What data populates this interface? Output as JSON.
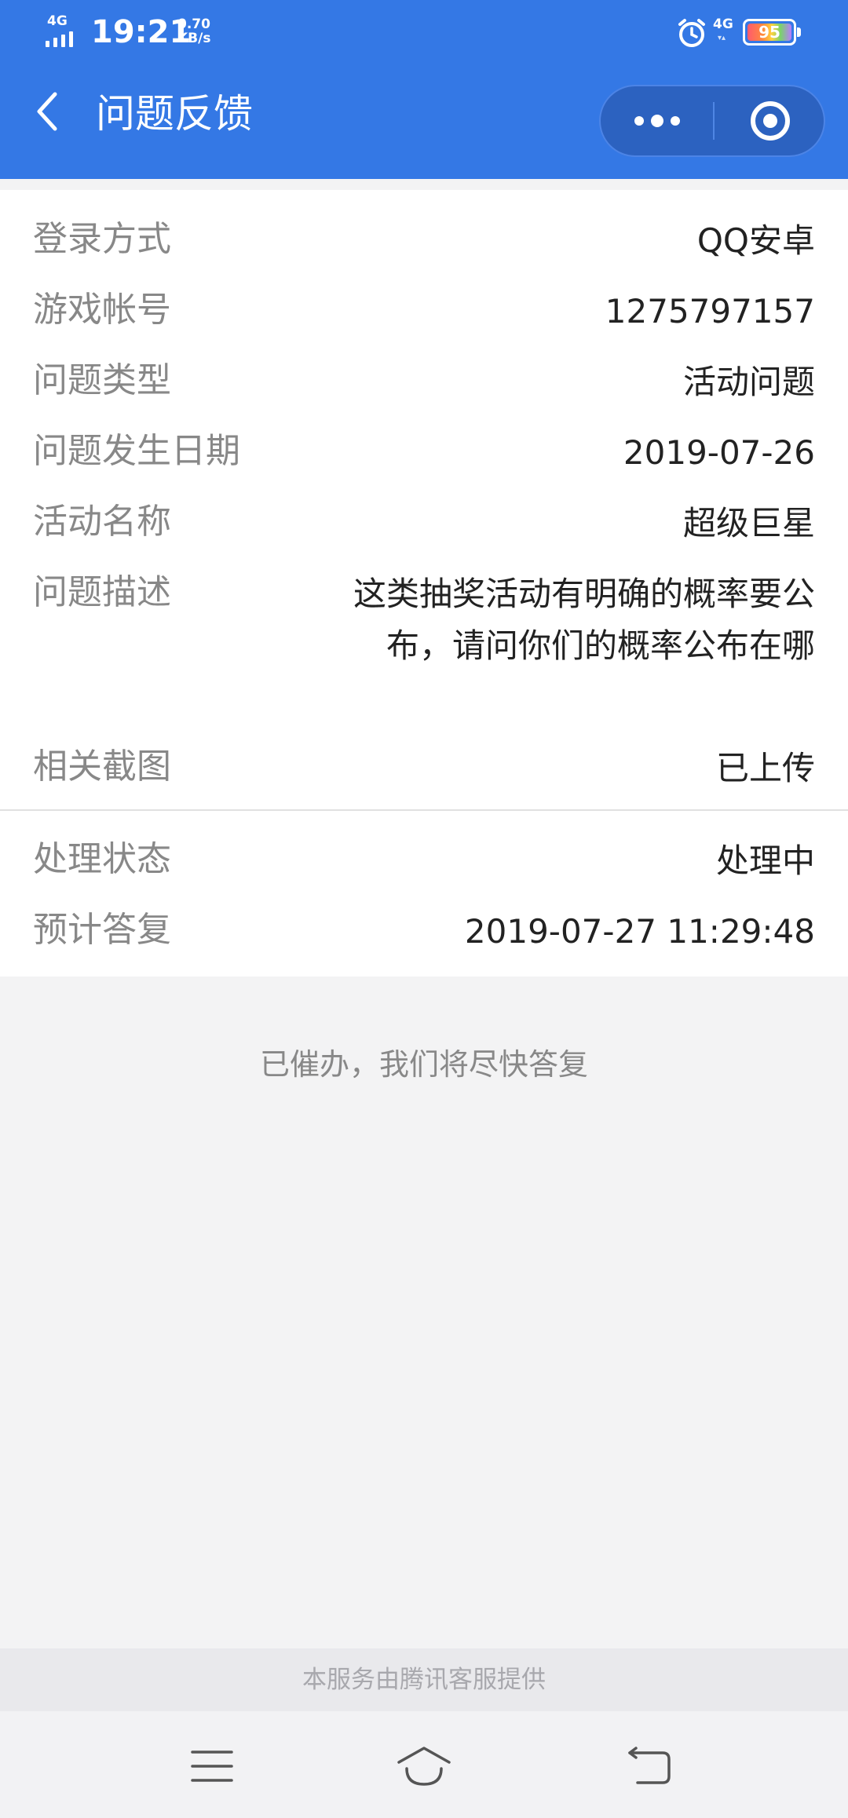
{
  "status_bar": {
    "network": "4G",
    "time": "19:21",
    "speed_value": "0.70",
    "speed_unit": "KB/s",
    "network_right": "4G",
    "battery_level": "95"
  },
  "nav": {
    "title": "问题反馈",
    "icons": {
      "back": "chevron-left-icon",
      "more": "more-dots-icon",
      "close": "target-close-icon"
    }
  },
  "details": {
    "login_method": {
      "label": "登录方式",
      "value": "QQ安卓"
    },
    "game_account": {
      "label": "游戏帐号",
      "value": "1275797157"
    },
    "issue_type": {
      "label": "问题类型",
      "value": "活动问题"
    },
    "issue_date": {
      "label": "问题发生日期",
      "value": "2019-07-26"
    },
    "activity_name": {
      "label": "活动名称",
      "value": "超级巨星"
    },
    "description": {
      "label": "问题描述",
      "value": "这类抽奖活动有明确的概率要公布，请问你们的概率公布在哪"
    },
    "screenshot": {
      "label": "相关截图",
      "value": "已上传"
    },
    "status": {
      "label": "处理状态",
      "value": "处理中"
    },
    "eta": {
      "label": "预计答复",
      "value": "2019-07-27 11:29:48"
    }
  },
  "notice": "已催办，我们将尽快答复",
  "footer": "本服务由腾讯客服提供",
  "system_nav": {
    "icons": [
      "menu-icon",
      "home-icon",
      "back-return-icon"
    ]
  },
  "colors": {
    "header": "#3478e5",
    "capsule": "#2c62c0",
    "background": "#f3f3f4"
  }
}
